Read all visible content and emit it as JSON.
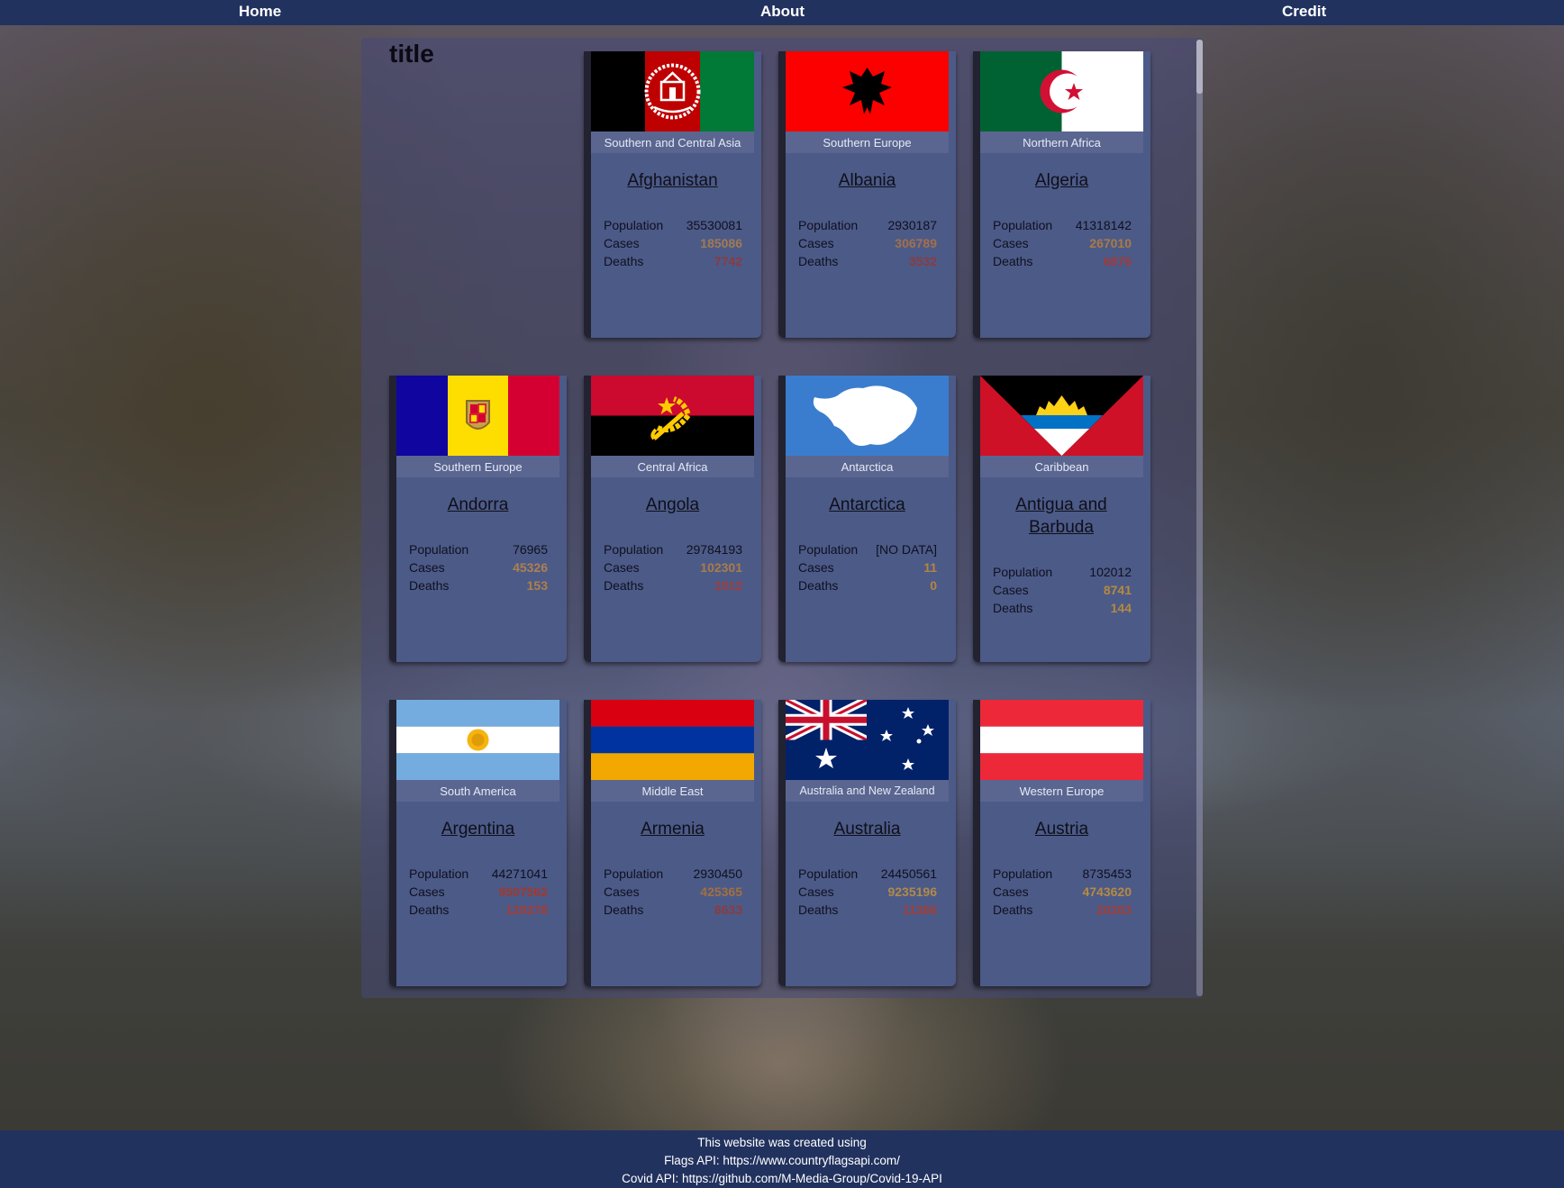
{
  "nav": {
    "home": "Home",
    "about": "About",
    "credit": "Credit"
  },
  "page": {
    "title": "title"
  },
  "labels": {
    "population": "Population",
    "cases": "Cases",
    "deaths": "Deaths"
  },
  "colors": {
    "nav_bg": "#22325f",
    "card_bg": "#4c5a87",
    "region_bg": "#5a6690"
  },
  "countries": [
    {
      "name": "Afghanistan",
      "region": "Southern and Central Asia",
      "population": "35530081",
      "cases": "185086",
      "deaths": "7742",
      "cases_color": "#a27a52",
      "deaths_color": "#8a3b3f",
      "flag_icon": "afghanistan-flag"
    },
    {
      "name": "Albania",
      "region": "Southern Europe",
      "population": "2930187",
      "cases": "306789",
      "deaths": "3532",
      "cases_color": "#a4704a",
      "deaths_color": "#8a3b3f",
      "flag_icon": "albania-flag"
    },
    {
      "name": "Algeria",
      "region": "Northern Africa",
      "population": "41318142",
      "cases": "267010",
      "deaths": "6876",
      "cases_color": "#ab7a45",
      "deaths_color": "#a13b3a",
      "flag_icon": "algeria-flag"
    },
    {
      "name": "Andorra",
      "region": "Southern Europe",
      "population": "76965",
      "cases": "45326",
      "deaths": "153",
      "cases_color": "#ad8050",
      "deaths_color": "#b07f48",
      "flag_icon": "andorra-flag"
    },
    {
      "name": "Angola",
      "region": "Central Africa",
      "population": "29784193",
      "cases": "102301",
      "deaths": "1912",
      "cases_color": "#a97c4a",
      "deaths_color": "#9e3e3c",
      "flag_icon": "angola-flag"
    },
    {
      "name": "Antarctica",
      "region": "Antarctica",
      "population": "[NO DATA]",
      "cases": "11",
      "deaths": "0",
      "cases_color": "#b48540",
      "deaths_color": "#b48540",
      "flag_icon": "antarctica-flag"
    },
    {
      "name": "Antigua and Barbuda",
      "region": "Caribbean",
      "population": "102012",
      "cases": "8741",
      "deaths": "144",
      "cases_color": "#b48a3e",
      "deaths_color": "#b08a40",
      "flag_icon": "antigua-and-barbuda-flag"
    },
    {
      "name": "Argentina",
      "region": "South America",
      "population": "44271041",
      "cases": "9507562",
      "deaths": "129278",
      "cases_color": "#a0392f",
      "deaths_color": "#a23d36",
      "flag_icon": "argentina-flag"
    },
    {
      "name": "Armenia",
      "region": "Middle East",
      "population": "2930450",
      "cases": "425365",
      "deaths": "8633",
      "cases_color": "#a2703f",
      "deaths_color": "#8a3c40",
      "flag_icon": "armenia-flag"
    },
    {
      "name": "Australia",
      "region": "Australia and New Zealand",
      "population": "24450561",
      "cases": "9235196",
      "deaths": "11386",
      "cases_color": "#b08a49",
      "deaths_color": "#a23e39",
      "flag_icon": "australia-flag"
    },
    {
      "name": "Austria",
      "region": "Western Europe",
      "population": "8735453",
      "cases": "4743620",
      "deaths": "20263",
      "cases_color": "#b58a43",
      "deaths_color": "#a13e3a",
      "flag_icon": "austria-flag"
    }
  ],
  "footer": {
    "line1": "This website was created using",
    "line2": "Flags API: https://www.countryflagsapi.com/",
    "line3": "Covid API: https://github.com/M-Media-Group/Covid-19-API"
  }
}
